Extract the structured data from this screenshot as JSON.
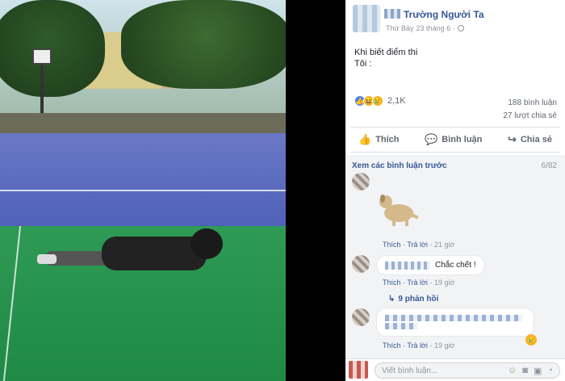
{
  "post": {
    "author": "Trường Người Ta",
    "meta_prefix": "Thứ Bảy",
    "date": "23 tháng 6",
    "text_line1": "Khi biết điểm thi",
    "text_line2": "Tôi :",
    "reaction_count": "2,1K",
    "comments_count": "188 bình luận",
    "shares_count": "27 lượt chia sẻ"
  },
  "actions": {
    "like": "Thích",
    "comment": "Bình luận",
    "share": "Chia sẻ"
  },
  "comments": {
    "view_previous": "Xem các bình luận trước",
    "page_count": "6/82",
    "items": [
      {
        "like": "Thích",
        "reply": "Trả lời",
        "time": "21 giờ"
      },
      {
        "text": "Chắc chết !",
        "like": "Thích",
        "reply": "Trả lời",
        "time": "19 giờ",
        "replies": "9 phản hồi"
      },
      {
        "like": "Thích",
        "reply": "Trả lời",
        "time": "19 giờ"
      }
    ]
  },
  "writer": {
    "placeholder": "Viết bình luận..."
  },
  "colors": {
    "link": "#365899",
    "muted": "#90949c",
    "like_blue": "#4080ff",
    "emoji_yellow": "#f7b125"
  },
  "icons": [
    "globe-icon",
    "like-icon",
    "comment-icon",
    "share-icon",
    "emoji-icon",
    "camera-icon",
    "gif-icon",
    "sticker-icon"
  ]
}
